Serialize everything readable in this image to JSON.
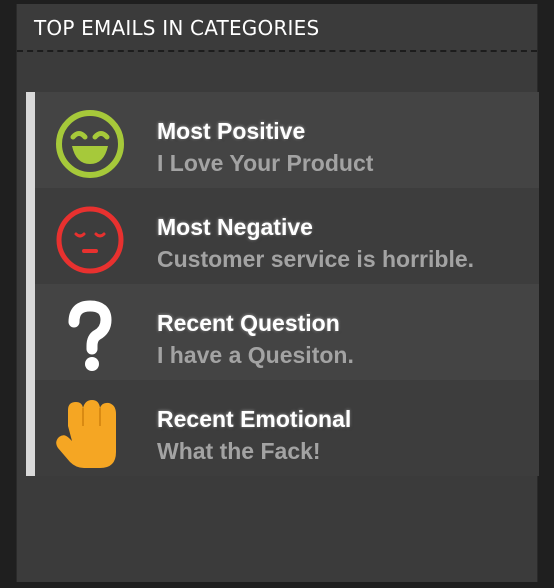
{
  "panel": {
    "title": "TOP EMAILS IN CATEGORIES"
  },
  "items": [
    {
      "title": "Most Positive",
      "subtitle": "I Love Your Product",
      "icon": "happy-face-icon",
      "color": "#a6c93a"
    },
    {
      "title": "Most Negative",
      "subtitle": "Customer service is horrible.",
      "icon": "sad-face-icon",
      "color": "#e8312f"
    },
    {
      "title": "Recent Question",
      "subtitle": "I have a Quesiton.",
      "icon": "question-mark-icon",
      "color": "#ffffff"
    },
    {
      "title": "Recent Emotional",
      "subtitle": "What the Fack!",
      "icon": "fist-icon",
      "color": "#f5a623"
    }
  ]
}
